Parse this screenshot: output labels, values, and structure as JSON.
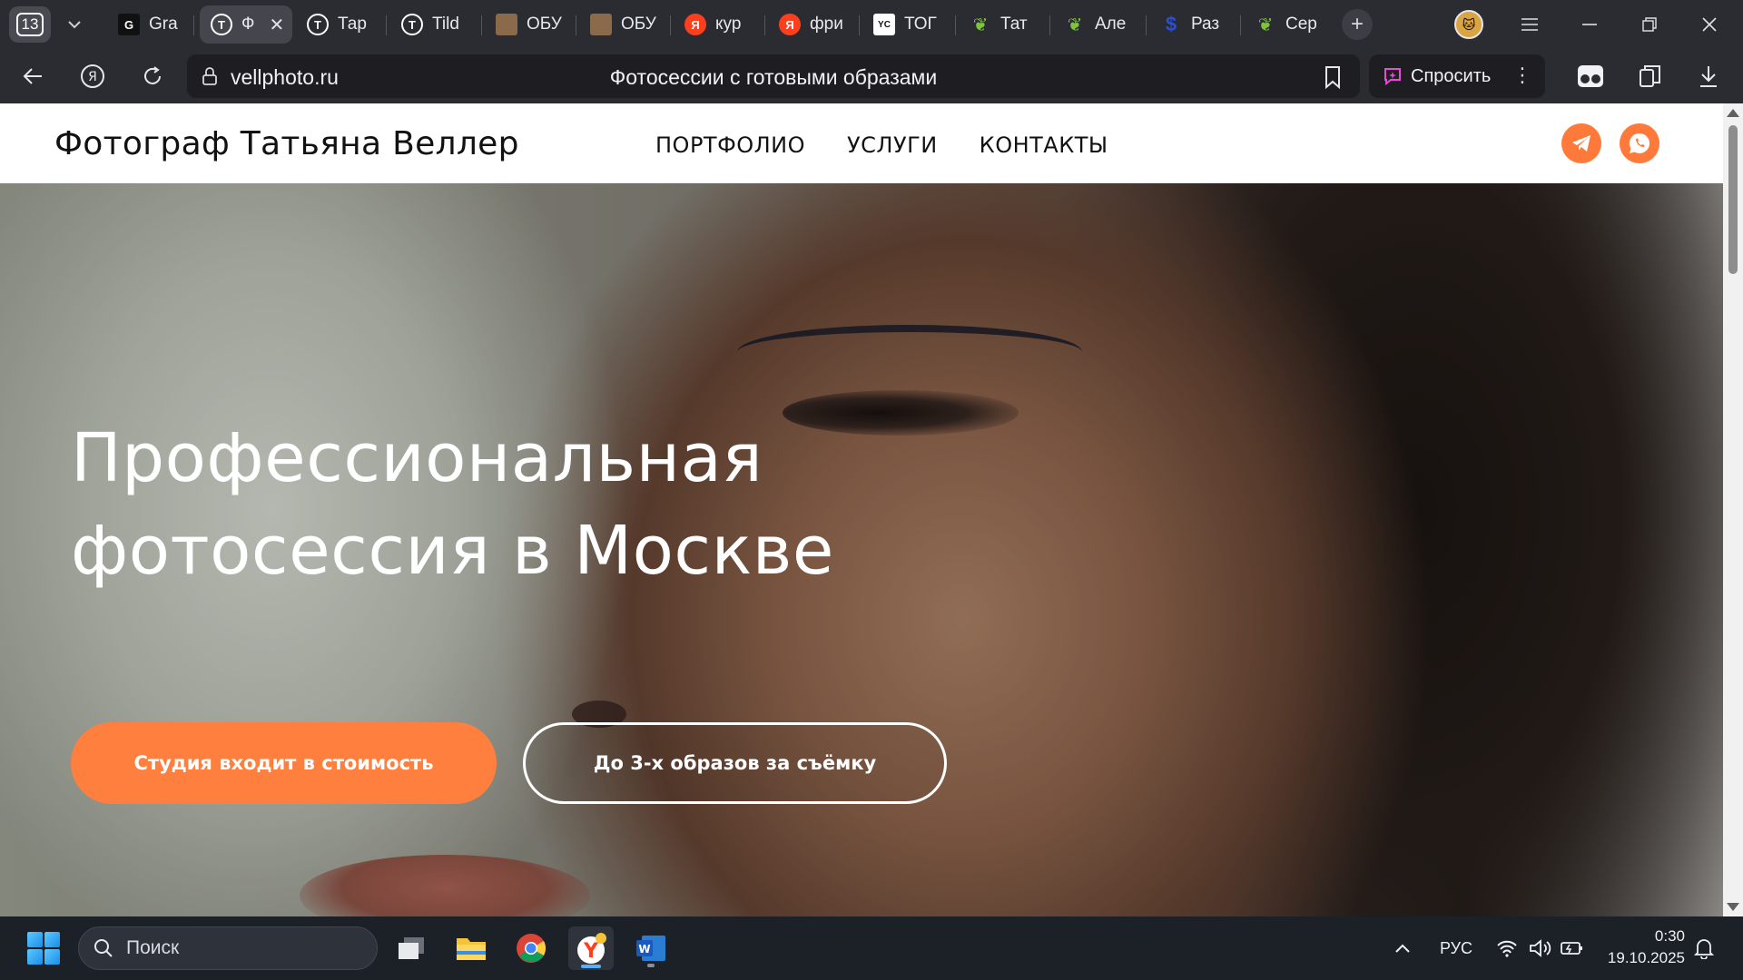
{
  "browser": {
    "tab_count": "13",
    "tabs": [
      {
        "label": "Gra",
        "icon": "gradient-favicon"
      },
      {
        "label": "Ф",
        "icon": "tilda-favicon",
        "active": true
      },
      {
        "label": "Тар",
        "icon": "tilda-favicon"
      },
      {
        "label": "Tild",
        "icon": "tilda-favicon"
      },
      {
        "label": "ОБУ",
        "icon": "photo-favicon"
      },
      {
        "label": "ОБУ",
        "icon": "photo-favicon"
      },
      {
        "label": "кур",
        "icon": "yandex-favicon"
      },
      {
        "label": "фри",
        "icon": "yandex-favicon"
      },
      {
        "label": "ТОГ",
        "icon": "yc-favicon"
      },
      {
        "label": "Тат",
        "icon": "green-leaf-favicon"
      },
      {
        "label": "Але",
        "icon": "green-leaf-favicon"
      },
      {
        "label": "Раз",
        "icon": "dollar-favicon"
      },
      {
        "label": "Сер",
        "icon": "green-leaf-favicon"
      }
    ],
    "url": "vellphoto.ru",
    "page_title": "Фотосессии с готовыми образами",
    "ask_label": "Спросить"
  },
  "site": {
    "logo": "Фотограф Татьяна Веллер",
    "menu": [
      "ПОРТФОЛИО",
      "УСЛУГИ",
      "КОНТАКТЫ"
    ],
    "hero": {
      "title_line1": "Профессиональная",
      "title_line2": "фотосессия в Москве",
      "cta_primary": "Студия входит в стоимость",
      "cta_secondary": "До 3-х образов за съёмку"
    },
    "accent_color": "#ff7f3e"
  },
  "taskbar": {
    "search_placeholder": "Поиск",
    "language": "РУС",
    "time": "0:30",
    "date": "19.10.2025"
  }
}
